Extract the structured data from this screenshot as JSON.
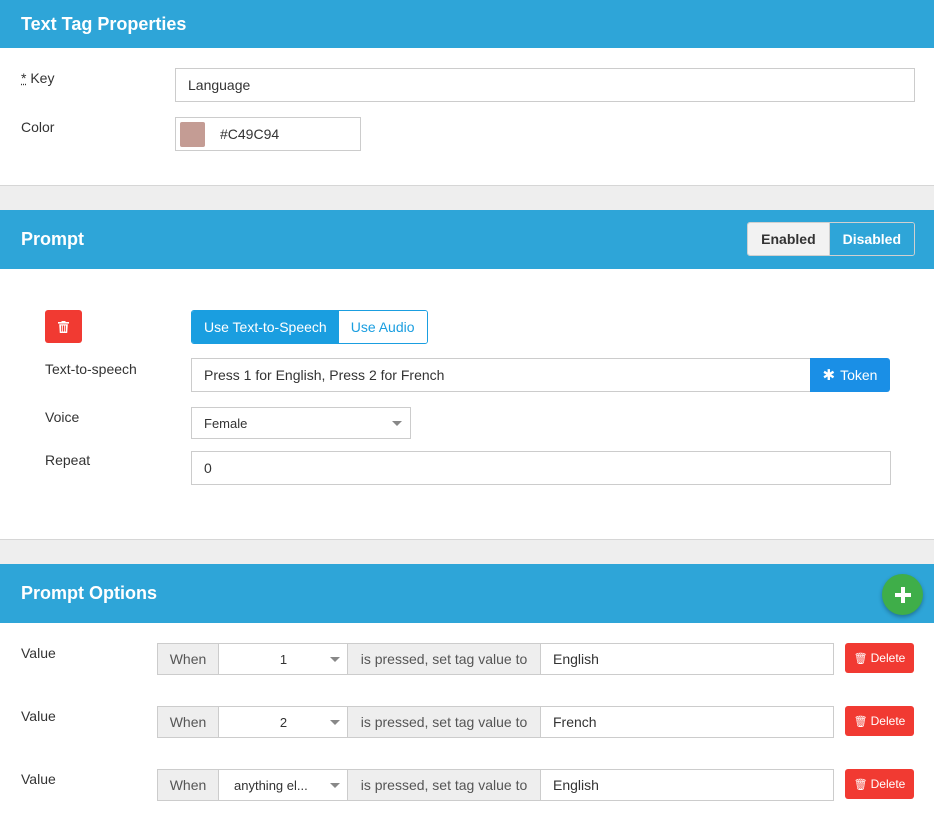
{
  "colors": {
    "header_bg": "#2ea5d8",
    "primary": "#1a9ee0",
    "danger": "#f13a32",
    "success": "#3fae49",
    "swatch": "#C49C94"
  },
  "properties": {
    "title": "Text Tag Properties",
    "key_required": "*",
    "key_label": "Key",
    "key_value": "Language",
    "color_label": "Color",
    "color_value": "#C49C94"
  },
  "prompt": {
    "title": "Prompt",
    "toggle_enabled": "Enabled",
    "toggle_disabled": "Disabled",
    "mode_tts": "Use Text-to-Speech",
    "mode_audio": "Use Audio",
    "tts_label": "Text-to-speech",
    "tts_value": "Press 1 for English, Press 2 for French",
    "token_button": "Token",
    "voice_label": "Voice",
    "voice_value": "Female",
    "repeat_label": "Repeat",
    "repeat_value": "0"
  },
  "options": {
    "title": "Prompt Options",
    "when_label": "When",
    "pressed_label": "is pressed, set tag value to",
    "delete_label": "Delete",
    "rows": [
      {
        "label": "Value",
        "key": "1",
        "value": "English"
      },
      {
        "label": "Value",
        "key": "2",
        "value": "French"
      },
      {
        "label": "Value",
        "key": "anything el...",
        "value": "English"
      }
    ]
  }
}
